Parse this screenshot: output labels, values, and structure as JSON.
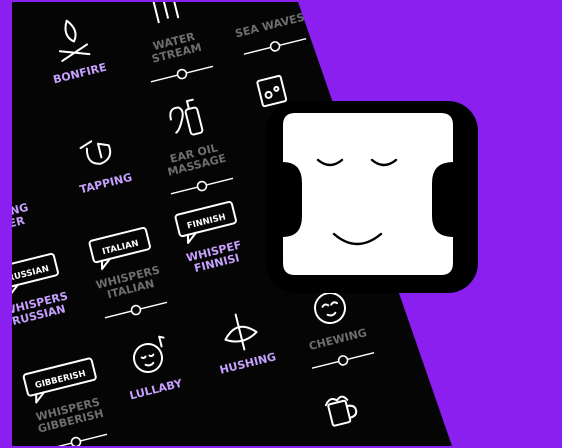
{
  "colors": {
    "accent": "#8a1ff0",
    "panel": "#050505",
    "label_active": "#c7a0ff",
    "label_dim": "#6e6e6e",
    "icon_line": "#ffffff",
    "app_icon_face": "#ffffff",
    "app_icon_frame": "#000000"
  },
  "sounds": [
    {
      "name": "bonfire",
      "label": "BONFIRE",
      "icon": "campfire-icon"
    },
    {
      "name": "water-stream",
      "label": "WATER\nSTREAM",
      "icon": "water-stream-icon"
    },
    {
      "name": "sea-waves",
      "label": "SEA WAVES",
      "icon": "waves-icon"
    },
    {
      "name": "crumpling-paper",
      "label": "PLING\nPER",
      "icon": "paper-icon"
    },
    {
      "name": "tapping",
      "label": "TAPPING",
      "icon": "tapping-hand-icon"
    },
    {
      "name": "ear-oil-massage",
      "label": "EAR OIL\nMASSAGE",
      "icon": "ear-oil-icon"
    },
    {
      "name": "glass-water",
      "label": "",
      "icon": "glass-icon"
    },
    {
      "name": "whispers-russian",
      "label": "WHISPERS\nRUSSIAN",
      "icon": "speech-bubble-icon",
      "bubble": "RUSSIAN"
    },
    {
      "name": "whispers-italian",
      "label": "WHISPERS\nITALIAN",
      "icon": "speech-bubble-icon",
      "bubble": "ITALIAN"
    },
    {
      "name": "whispers-finnish",
      "label": "WHISPEF\nFINNISI",
      "icon": "speech-bubble-icon",
      "bubble": "FINNISH"
    },
    {
      "name": "whispers-gibberish",
      "label": "WHISPERS\nGIBBERISH",
      "icon": "speech-bubble-icon",
      "bubble": "GIBBERISH"
    },
    {
      "name": "lullaby",
      "label": "LULLABY",
      "icon": "baby-face-icon"
    },
    {
      "name": "hushing",
      "label": "HUSHING",
      "icon": "hushing-icon"
    },
    {
      "name": "chewing",
      "label": "CHEWING",
      "icon": "chewing-face-icon"
    },
    {
      "name": "beer",
      "label": "",
      "icon": "beer-mug-icon"
    }
  ],
  "app_icon": {
    "name": "relax-face-icon"
  }
}
